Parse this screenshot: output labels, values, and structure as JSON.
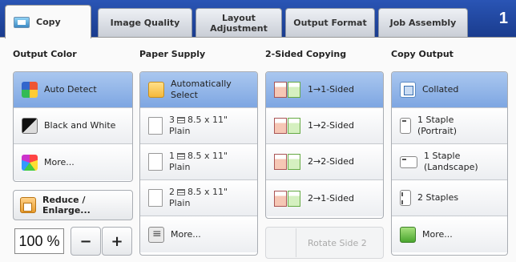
{
  "tabs": [
    {
      "label": "Copy",
      "active": true
    },
    {
      "label": "Image Quality",
      "active": false
    },
    {
      "label": "Layout\nAdjustment",
      "active": false
    },
    {
      "label": "Output Format",
      "active": false
    },
    {
      "label": "Job Assembly",
      "active": false
    }
  ],
  "page_indicator": "1",
  "output_color": {
    "heading": "Output Color",
    "options": [
      "Auto Detect",
      "Black and White",
      "More..."
    ],
    "selected": "Auto Detect"
  },
  "reduce_enlarge": {
    "label": "Reduce / Enlarge...",
    "value": "100 %",
    "minus": "−",
    "plus": "+"
  },
  "paper_supply": {
    "heading": "Paper Supply",
    "options": [
      {
        "line1": "Automatically",
        "line2": "Select"
      },
      {
        "tray": "3",
        "size": "8.5 x 11\"",
        "type": "Plain"
      },
      {
        "tray": "1",
        "size": "8.5 x 11\"",
        "type": "Plain"
      },
      {
        "tray": "2",
        "size": "8.5 x 11\"",
        "type": "Plain"
      },
      {
        "line1": "More..."
      }
    ],
    "selected": "Automatically Select"
  },
  "two_sided": {
    "heading": "2-Sided Copying",
    "options": [
      "1→1-Sided",
      "1→2-Sided",
      "2→2-Sided",
      "2→1-Sided"
    ],
    "selected": "1→1-Sided",
    "rotate_label": "Rotate Side 2"
  },
  "copy_output": {
    "heading": "Copy Output",
    "options": [
      {
        "line1": "Collated"
      },
      {
        "line1": "1 Staple",
        "line2": "(Portrait)"
      },
      {
        "line1": "1 Staple",
        "line2": "(Landscape)"
      },
      {
        "line1": "2 Staples"
      },
      {
        "line1": "More..."
      }
    ],
    "selected": "Collated"
  },
  "colors": {
    "selected_bg": "#7ea6e2",
    "header_bg": "#1a3c8e",
    "accent_green": "#4aa62f"
  }
}
